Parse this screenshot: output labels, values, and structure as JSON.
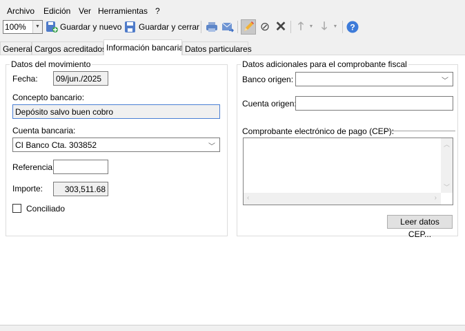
{
  "menu": [
    "Archivo",
    "Edición",
    "Ver",
    "Herramientas",
    "?"
  ],
  "toolbar": {
    "zoom": "100%",
    "save_new": "Guardar y nuevo",
    "save_close": "Guardar y cerrar"
  },
  "tabs": [
    "General",
    "Cargos acreditados",
    "Información bancaria",
    "Datos particulares"
  ],
  "left_group": {
    "title": "Datos del movimiento",
    "fecha_label": "Fecha:",
    "fecha": "09/jun./2025",
    "concepto_label": "Concepto bancario:",
    "concepto": "Depósito salvo buen cobro",
    "cuenta_label": "Cuenta bancaria:",
    "cuenta": "CI Banco Cta. 303852",
    "referencia_label": "Referencia:",
    "referencia": "",
    "importe_label": "Importe:",
    "importe": "303,511.68",
    "conciliado_label": "Conciliado",
    "conciliado": false
  },
  "right_group": {
    "title": "Datos adicionales para el comprobante fiscal",
    "banco_label": "Banco origen:",
    "banco": "",
    "cuenta_label": "Cuenta origen:",
    "cuenta": "",
    "cep_label": "Comprobante electrónico de pago (CEP):",
    "cep": "",
    "leer_button": "Leer datos CEP..."
  },
  "colors": {
    "accent": "#2f6fd1",
    "focus_border": "#4a7fd4"
  }
}
